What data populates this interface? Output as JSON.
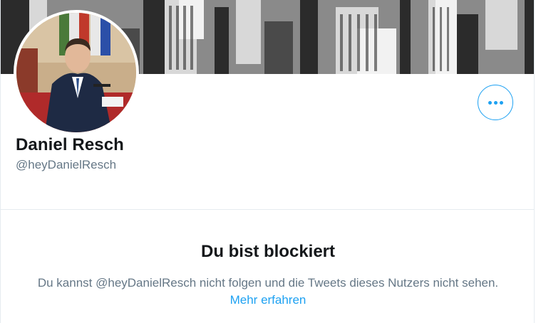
{
  "profile": {
    "display_name": "Daniel Resch",
    "handle": "@heyDanielResch",
    "banner": "city-skyline-photo",
    "avatar": "profile-photo"
  },
  "actions": {
    "more_icon": "more-horizontal-icon"
  },
  "blocked_notice": {
    "title": "Du bist blockiert",
    "message": "Du kannst @heyDanielResch nicht folgen und die Tweets dieses Nutzers nicht sehen.",
    "link_label": "Mehr erfahren"
  },
  "colors": {
    "accent": "#1da1f2",
    "text_primary": "#14171a",
    "text_secondary": "#657786",
    "border": "#e6ecf0"
  }
}
